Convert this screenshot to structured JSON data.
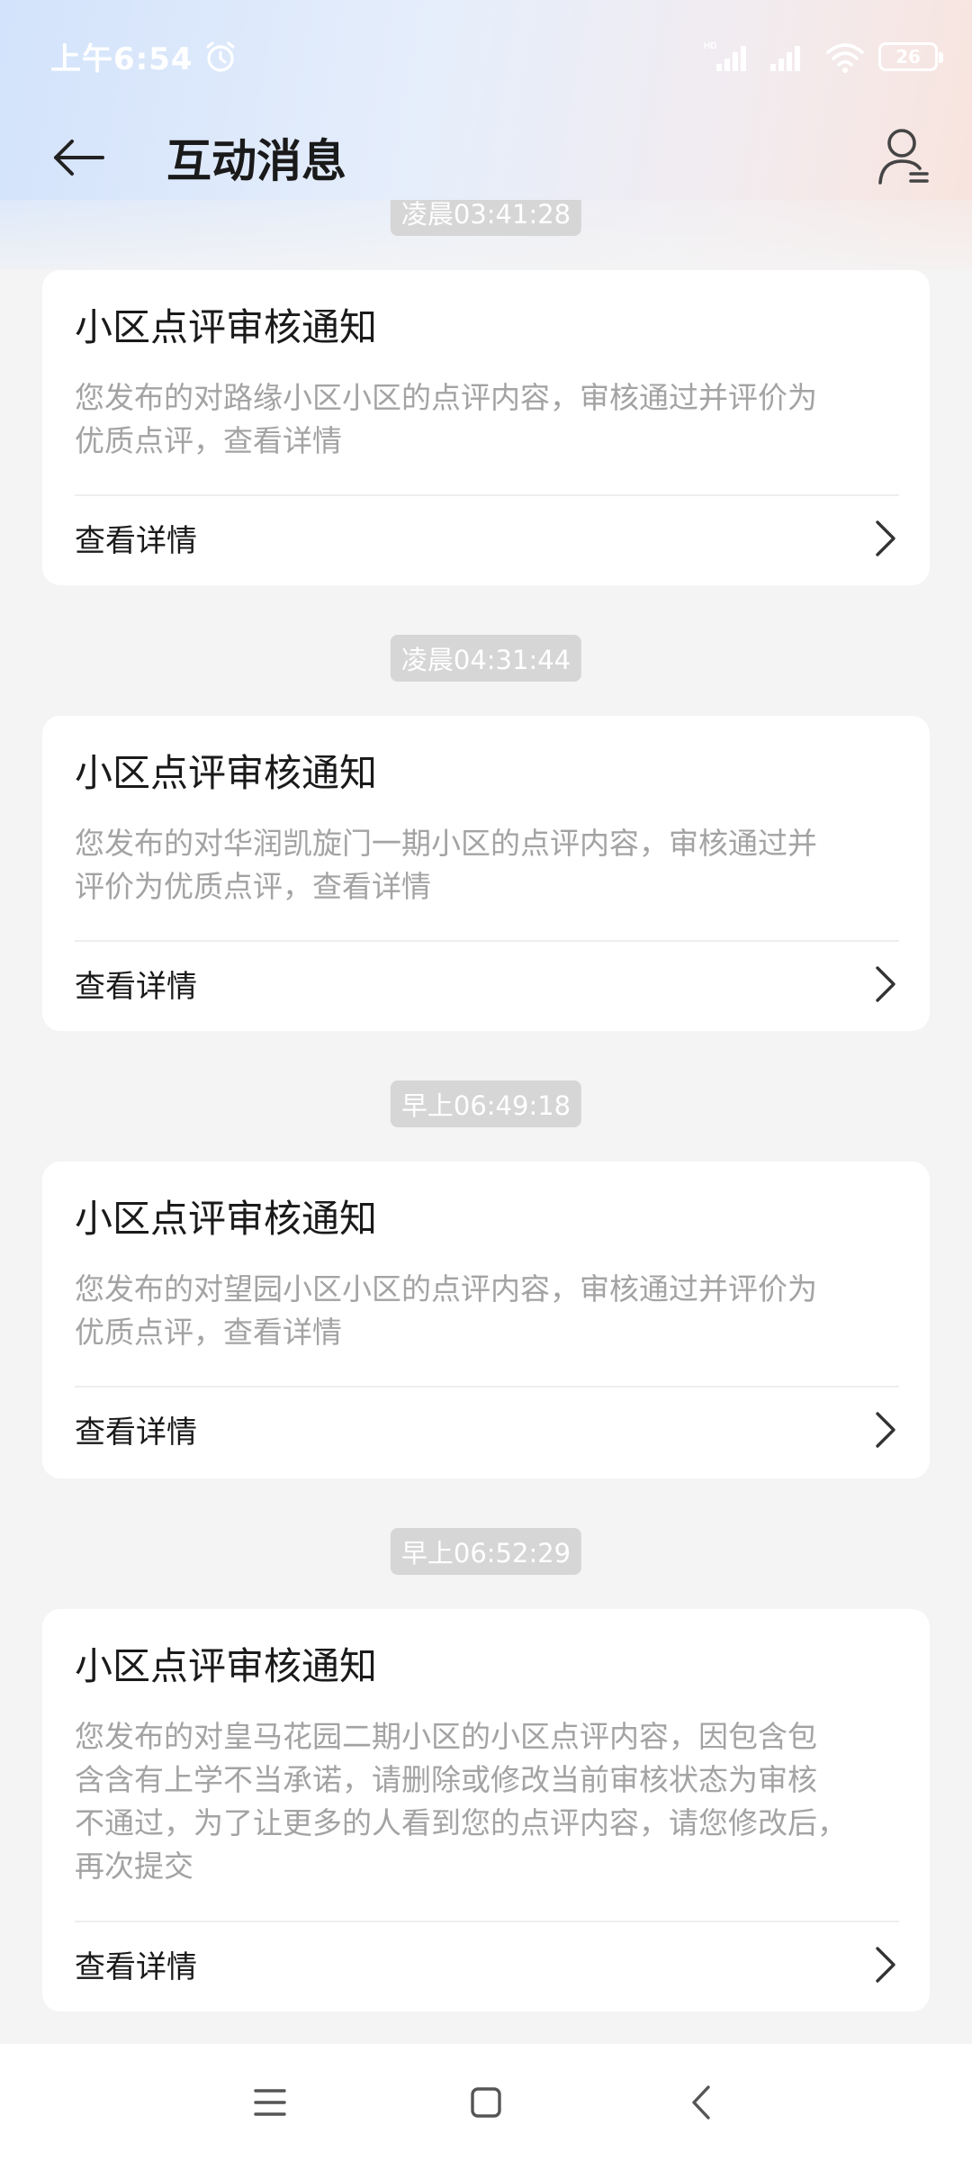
{
  "status_bar": {
    "time": "上午6:54",
    "signal_badge": "HD",
    "battery": "26"
  },
  "header": {
    "title": "互动消息"
  },
  "messages": [
    {
      "timestamp": "凌晨03:41:28",
      "title": "小区点评审核通知",
      "lines": [
        "您发布的对路缘小区小区的点评内容，审核通过并评价为",
        "优质点评，查看详情"
      ],
      "link_label": "查看详情"
    },
    {
      "timestamp": "凌晨04:31:44",
      "title": "小区点评审核通知",
      "lines": [
        "您发布的对华润凯旋门一期小区的点评内容，审核通过并",
        "评价为优质点评，查看详情"
      ],
      "link_label": "查看详情"
    },
    {
      "timestamp": "早上06:49:18",
      "title": "小区点评审核通知",
      "lines": [
        "您发布的对望园小区小区的点评内容，审核通过并评价为",
        "优质点评，查看详情"
      ],
      "link_label": "查看详情"
    },
    {
      "timestamp": "早上06:52:29",
      "title": "小区点评审核通知",
      "lines": [
        "您发布的对皇马花园二期小区的小区点评内容，因包含包",
        "含含有上学不当承诺，请删除或修改当前审核状态为审核",
        "不通过，为了让更多的人看到您的点评内容，请您修改后，",
        "再次提交"
      ],
      "link_label": "查看详情"
    }
  ]
}
